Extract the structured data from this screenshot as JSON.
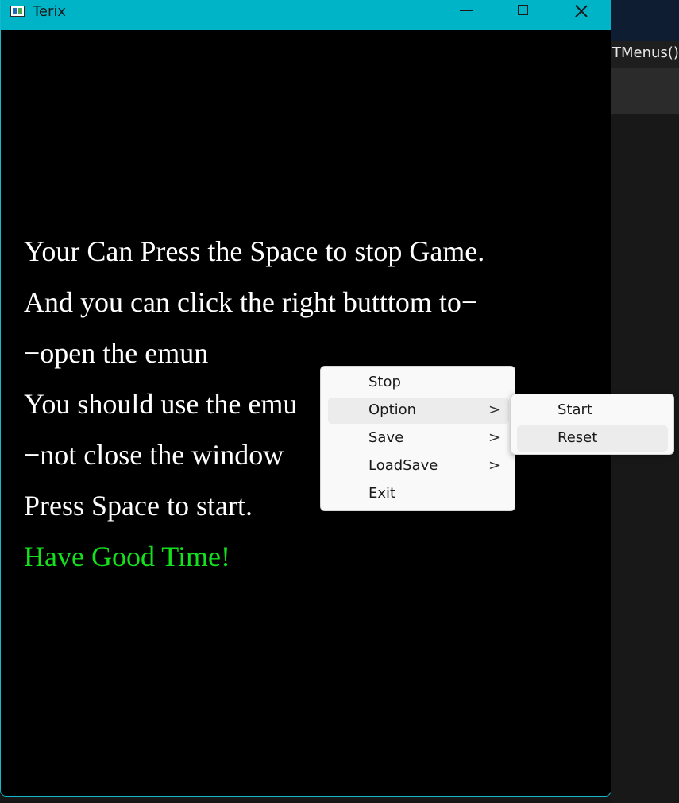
{
  "background_editor": {
    "code_text": "TMenus()"
  },
  "window": {
    "title": "Terix",
    "controls": {
      "minimize_icon": "minimize-icon",
      "maximize_icon": "maximize-icon",
      "close_icon": "close-icon"
    },
    "titlebar_color": "#00b4c8"
  },
  "content": {
    "lines": [
      "Your Can Press the Space to stop Game.",
      "And you can click the right butttom to−",
      "−open the emun",
      "You should use the emu",
      "−not close the window",
      "Press Space to start."
    ],
    "highlight_line": "Have Good Time!",
    "highlight_color": "#14e01e"
  },
  "context_menu": {
    "items": [
      {
        "label": "Stop",
        "has_submenu": false
      },
      {
        "label": "Option",
        "has_submenu": true
      },
      {
        "label": "Save",
        "has_submenu": true
      },
      {
        "label": "LoadSave",
        "has_submenu": true
      },
      {
        "label": "Exit",
        "has_submenu": false
      }
    ],
    "submenu_arrow": ">",
    "submenu": {
      "items": [
        {
          "label": "Start"
        },
        {
          "label": "Reset"
        }
      ]
    }
  }
}
